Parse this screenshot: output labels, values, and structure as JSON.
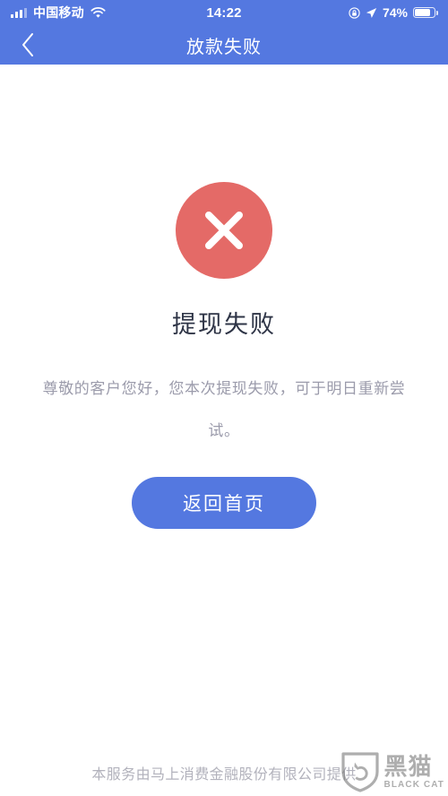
{
  "status_bar": {
    "carrier": "中国移动",
    "time": "14:22",
    "battery_percent": "74%",
    "icons": {
      "signal": "signal-bars-icon",
      "wifi": "wifi-icon",
      "rotation_lock": "rotation-lock-icon",
      "location": "location-arrow-icon",
      "battery": "battery-icon"
    }
  },
  "nav_bar": {
    "back_icon": "chevron-left-icon",
    "title": "放款失败"
  },
  "result": {
    "status_icon": "error-cross-icon",
    "headline": "提现失败",
    "message": "尊敬的客户您好，您本次提现失败，可于明日重新尝试。",
    "primary_button": "返回首页"
  },
  "footer": {
    "disclaimer": "本服务由马上消费金融股份有限公司提供",
    "watermark_cn": "黑猫",
    "watermark_en": "BLACK CAT",
    "watermark_icon": "black-cat-shield-logo"
  },
  "colors": {
    "brand_blue": "#5478e0",
    "error_red": "#e46a67",
    "headline_text": "#2e3446",
    "body_text": "#9b9bab",
    "footer_text": "#b2b2bc",
    "page_background": "#ffffff"
  }
}
